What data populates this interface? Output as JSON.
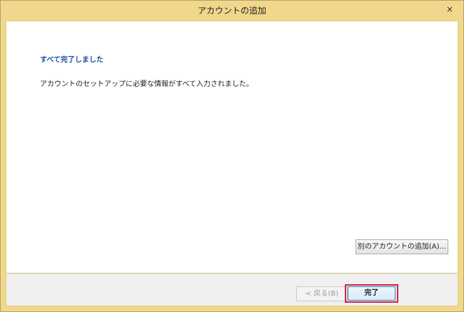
{
  "window": {
    "title": "アカウントの追加",
    "close_glyph": "×"
  },
  "content": {
    "heading": "すべて完了しました",
    "message": "アカウントのセットアップに必要な情報がすべて入力されました。",
    "add_other_account_label": "別のアカウントの追加(A)..."
  },
  "footer": {
    "back_label": "< 戻る(B)",
    "finish_label": "完了"
  },
  "colors": {
    "frame": "#f0d78c",
    "heading": "#1d4fa6",
    "highlight": "#d3214a"
  }
}
